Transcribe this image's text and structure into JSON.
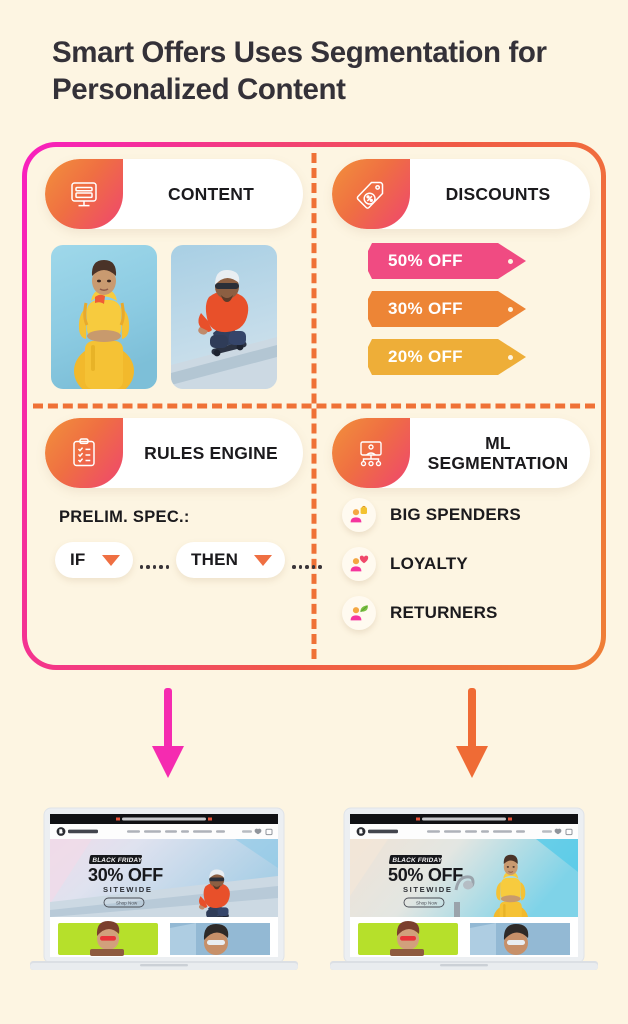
{
  "page": {
    "title": "Smart Offers Uses Segmentation for Personalized Content",
    "background_color": "#fdf5e2",
    "border_gradient_from": "#f81fc0",
    "border_gradient_to": "#ef7f36",
    "divider_color": "#ef7136"
  },
  "quadrants": {
    "content": {
      "label": "CONTENT",
      "icon": "monitor-icon",
      "photos": [
        {
          "name": "woman-yellow-tracksuit-photo",
          "alt": "Woman in yellow tracksuit on blue background"
        },
        {
          "name": "man-skateboard-photo",
          "alt": "Man in red hoodie crouching on skateboard ramp"
        }
      ]
    },
    "discounts": {
      "label": "DISCOUNTS",
      "icon": "price-tag-percent-icon",
      "tags": [
        {
          "label": "50% OFF",
          "color": "#f04b82"
        },
        {
          "label": "30% OFF",
          "color": "#ed8536"
        },
        {
          "label": "20% OFF",
          "color": "#eeae38"
        }
      ]
    },
    "rules_engine": {
      "label": "RULES ENGINE",
      "icon": "clipboard-checklist-icon",
      "spec_label": "PRELIM. SPEC.:",
      "conditions": [
        {
          "label": "IF",
          "caret": "chevron-down-icon"
        },
        {
          "label": "THEN",
          "caret": "chevron-down-icon"
        }
      ]
    },
    "ml_segmentation": {
      "label_line1": "ML",
      "label_line2": "SEGMENTATION",
      "icon": "network-segmentation-icon",
      "segments": [
        {
          "label": "BIG SPENDERS",
          "icon": "user-shopping-bag-icon"
        },
        {
          "label": "LOYALTY",
          "icon": "user-heart-icon"
        },
        {
          "label": "RETURNERS",
          "icon": "user-leaf-icon"
        }
      ]
    }
  },
  "arrows": [
    {
      "name": "arrow-to-left-output",
      "color": "#f52bb0"
    },
    {
      "name": "arrow-to-right-output",
      "color": "#ef6b35"
    }
  ],
  "outputs": [
    {
      "name": "laptop-30-off",
      "banner_text": "Black Friday BOMB | 40% Off Sitewide, just for you!",
      "brand": "BESTFRIEND",
      "nav": [
        "Featured",
        "New Arrivals",
        "Women",
        "Men",
        "Accessories",
        "Sale"
      ],
      "utility": [
        "Search"
      ],
      "hero_kicker": "BLACK FRIDAY",
      "hero_offer": "30% OFF",
      "hero_sub": "SITEWIDE",
      "hero_cta": "Shop Now",
      "hero_image": "man-skateboard-photo"
    },
    {
      "name": "laptop-50-off",
      "banner_text": "Black Friday BOMB | 40% Off Sitewide, just for you!",
      "brand": "BESTFRIEND",
      "nav": [
        "Featured",
        "New Arrivals",
        "Women",
        "Men",
        "Accessories",
        "Sale"
      ],
      "utility": [
        "Search"
      ],
      "hero_kicker": "BLACK FRIDAY",
      "hero_offer": "50% OFF",
      "hero_sub": "SITEWIDE",
      "hero_cta": "Shop Now",
      "hero_image": "woman-yellow-tracksuit-photo"
    }
  ]
}
